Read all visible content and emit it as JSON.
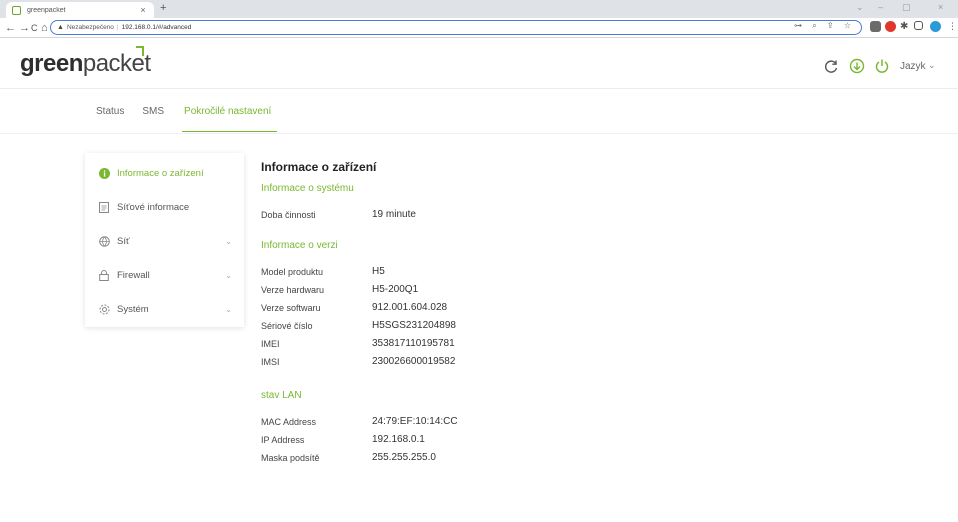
{
  "browser": {
    "tab_title": "greenpacket",
    "tab_close": "×",
    "new_tab": "+",
    "win_min": "–",
    "win_max": "▢",
    "win_close": "×",
    "win_collapse": "⌄",
    "back": "←",
    "forward": "→",
    "reload": "C",
    "home": "⌂",
    "security_label": "Nezabezpečeno",
    "url": "192.168.0.1/#/advanced",
    "omni_icons": "⊶ ⌕ ⇪ ☆"
  },
  "header": {
    "logo_bold": "green",
    "logo_rest": "packet",
    "language_label": "Jazyk",
    "language_chevron": "⌄"
  },
  "nav": {
    "tabs": [
      {
        "label": "Status"
      },
      {
        "label": "SMS"
      },
      {
        "label": "Pokročilé nastavení"
      }
    ]
  },
  "sidebar": {
    "items": [
      {
        "label": "Informace o zařízení",
        "icon": "info-icon"
      },
      {
        "label": "Síťové informace",
        "icon": "document-icon"
      },
      {
        "label": "Síť",
        "icon": "globe-icon",
        "chevron": "⌄"
      },
      {
        "label": "Firewall",
        "icon": "lock-icon",
        "chevron": "⌄"
      },
      {
        "label": "Systém",
        "icon": "gear-icon",
        "chevron": "⌄"
      }
    ]
  },
  "content": {
    "title": "Informace o zařízení",
    "system_section": {
      "title": "Informace o systému",
      "rows": [
        {
          "key": "Doba činnosti",
          "value": "19 minute"
        }
      ]
    },
    "version_section": {
      "title": "Informace o verzi",
      "rows": [
        {
          "key": "Model produktu",
          "value": "H5"
        },
        {
          "key": "Verze hardwaru",
          "value": "H5-200Q1"
        },
        {
          "key": "Verze softwaru",
          "value": "912.001.604.028"
        },
        {
          "key": "Sériové číslo",
          "value": "H5SGS231204898"
        },
        {
          "key": "IMEI",
          "value": "353817110195781"
        },
        {
          "key": "IMSI",
          "value": "230026600019582"
        }
      ]
    },
    "lan_section": {
      "title": "stav LAN",
      "rows": [
        {
          "key": "MAC Address",
          "value": "24:79:EF:10:14:CC"
        },
        {
          "key": "IP Address",
          "value": "192.168.0.1"
        },
        {
          "key": "Maska podsítě",
          "value": "255.255.255.0"
        }
      ]
    }
  },
  "colors": {
    "accent": "#7ab830",
    "omnibox_border": "#4a7bd8"
  }
}
